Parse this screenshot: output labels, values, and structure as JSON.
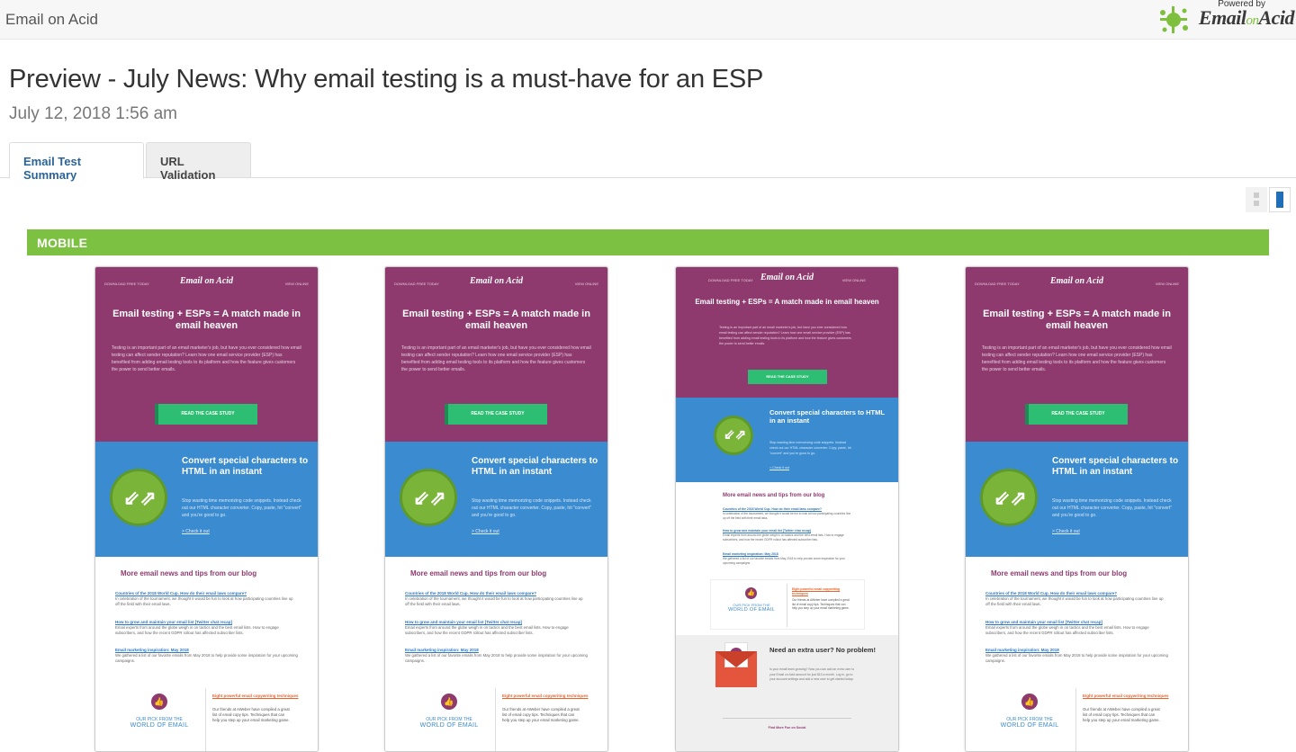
{
  "topbar": {
    "brand": "Email on Acid",
    "logo": {
      "powered": "Powered by",
      "word_email": "Email",
      "word_on": "on",
      "word_acid": "Acid"
    }
  },
  "page": {
    "title": "Preview - July News: Why email testing is a must-have for an ESP",
    "date": "July 12, 2018 1:56 am"
  },
  "tabs": [
    {
      "label": "Email Test Summary",
      "active": true
    },
    {
      "label": "URL Validation",
      "active": false
    }
  ],
  "section": {
    "label": "MOBILE",
    "color": "#7cc142"
  },
  "email": {
    "top_left": "DOWNLOAD FREE TODAY",
    "top_right": "VIEW ONLINE",
    "mini_logo": "Email on Acid",
    "hero_title": "Email testing + ESPs = A match made in email heaven",
    "hero_body": "Testing is an important part of an email marketer's job, but have you ever considered how email testing can affect sender reputation? Learn how one email service provider (ESP) has benefited from adding email testing tools to its platform and how the feature gives customers the power to send better emails.",
    "cta": "READ THE CASE STUDY",
    "blue_title": "Convert special characters to HTML in an instant",
    "blue_body": "Stop wasting time memorizing code snippets. Instead check out our HTML character converter. Copy, paste, hit \"convert\" and you're good to go.",
    "blue_link": "> Check it out",
    "blog_heading": "More email news and tips from our blog",
    "blog": [
      {
        "title": "Countries of the 2018 World Cup. How do their email laws compare?",
        "desc": "In celebration of the tournament, we thought it would be fun to look at how participating countries line up off the field with their email laws."
      },
      {
        "title": "How to grow and maintain your email list [Twitter chat recap]",
        "desc": "Email experts from around the globe weigh in on tactics and the best email lists. How to engage subscribers, and how the recent GDPR rollout has affected subscriber lists."
      },
      {
        "title": "Email marketing inspiration: May 2018",
        "desc": "We gathered a list of our favorite emails from May 2018 to help provide some inspiration for your upcoming campaigns."
      }
    ],
    "pick_label_1": "OUR PICK FROM THE",
    "pick_label_2": "WORLD OF EMAIL",
    "pick_title": "Eight powerful email copywriting techniques",
    "pick_desc": "Our friends at AWeber have compiled a great list of email copy tips. Techniques that can help you step up your email marketing game.",
    "gray_title": "Need an extra user? No problem!",
    "gray_body": "Is your email team growing? Now you can add an extra user to your Email on Acid account for just $10 a month. Log in, go to your account settings and add a new user to get started today.",
    "gray_foot": "Find More Fun on Social"
  },
  "view_toggle": {
    "grid_icon": "grid-view-icon",
    "list_icon": "list-view-icon",
    "accent": "#1f6fb8"
  }
}
